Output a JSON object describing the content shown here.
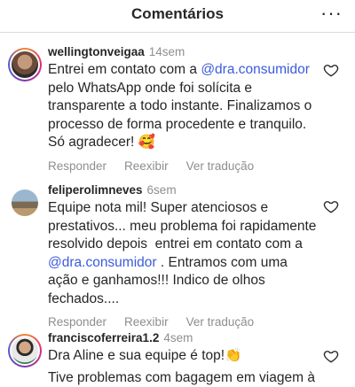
{
  "header": {
    "title": "Comentários",
    "more_icon": "ellipsis-horizontal-icon"
  },
  "comments": [
    {
      "username": "wellingtonveigaa",
      "time": "14sem",
      "text_before": "Entrei em contato com a ",
      "mention": "@dra.consumidor",
      "text_after": " pelo WhatsApp onde foi solícita e transparente a todo instante. Finalizamos o processo de forma procedente e tranquilo. Só agradecer! 🥰",
      "actions": [
        "Responder",
        "Reexibir",
        "Ver tradução"
      ]
    },
    {
      "username": "feliperolimneves",
      "time": "6sem",
      "text_before": "Equipe nota mil! Super atenciosos e prestativos... meu problema foi rapidamente resolvido depois  entrei em contato com a ",
      "mention": "@dra.consumidor",
      "text_after": " . Entramos com uma ação e ganhamos!!! Indico de olhos fechados....",
      "actions": [
        "Responder",
        "Reexibir",
        "Ver tradução"
      ]
    },
    {
      "username": "franciscoferreira1.2",
      "time": "4sem",
      "text_before": "Dra Aline e sua equipe é top!👏",
      "mention": "",
      "text_after": "",
      "actions": []
    }
  ],
  "partial_line": "Tive problemas com bagagem em viagem à"
}
